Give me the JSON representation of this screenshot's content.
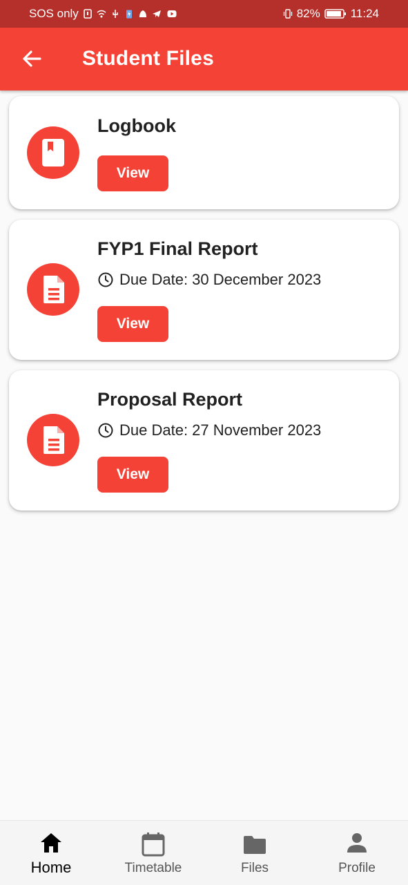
{
  "status_bar": {
    "left_text": "SOS only",
    "battery": "82%",
    "time": "11:24"
  },
  "app_bar": {
    "title": "Student Files",
    "back_icon": "arrow-back-icon"
  },
  "files": [
    {
      "title": "Logbook",
      "icon": "book-icon",
      "button": "View"
    },
    {
      "title": "FYP1 Final Report",
      "due": "Due Date: 30 December 2023",
      "icon": "document-icon",
      "button": "View"
    },
    {
      "title": "Proposal Report",
      "due": "Due Date: 27 November 2023",
      "icon": "document-icon",
      "button": "View"
    }
  ],
  "bottom_nav": {
    "items": [
      {
        "label": "Home",
        "icon": "home-icon",
        "active": true
      },
      {
        "label": "Timetable",
        "icon": "calendar-icon",
        "active": false
      },
      {
        "label": "Files",
        "icon": "folder-icon",
        "active": false
      },
      {
        "label": "Profile",
        "icon": "person-icon",
        "active": false
      }
    ]
  },
  "colors": {
    "primary": "#f44336",
    "status_bar": "#b5302b",
    "background": "#fafafa"
  }
}
